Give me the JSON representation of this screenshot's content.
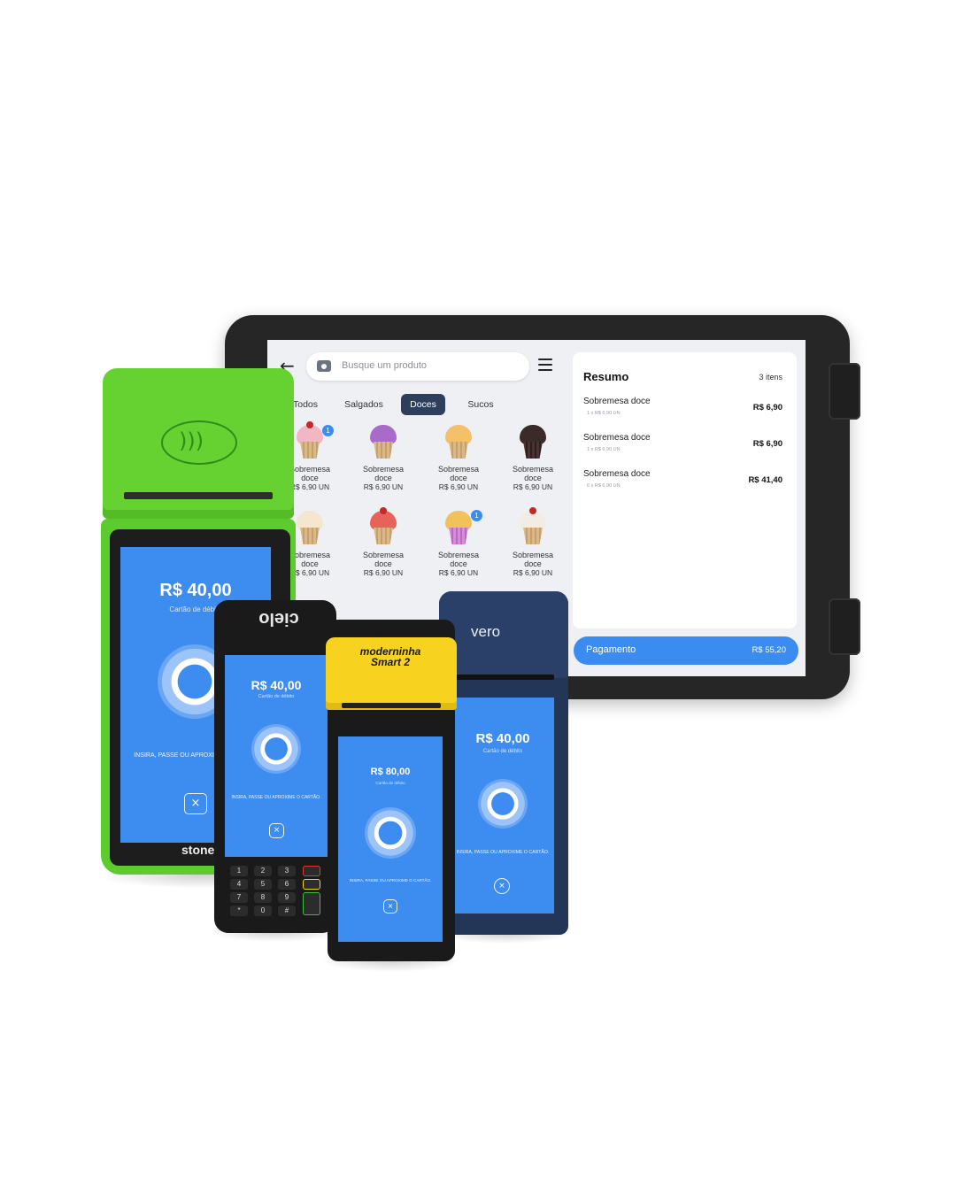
{
  "tablet_app": {
    "search": {
      "placeholder": "Busque um produto"
    },
    "tabs": [
      {
        "label": "Todos"
      },
      {
        "label": "Salgados"
      },
      {
        "label": "Doces",
        "active": true
      },
      {
        "label": "Sucos"
      }
    ],
    "products": [
      {
        "name_line1": "Sobremesa",
        "name_line2": "doce",
        "price": "R$ 6,90 UN",
        "badge": "1"
      },
      {
        "name_line1": "Sobremesa",
        "name_line2": "doce",
        "price": "R$ 6,90 UN"
      },
      {
        "name_line1": "Sobremesa",
        "name_line2": "doce",
        "price": "R$ 6,90 UN"
      },
      {
        "name_line1": "Sobremesa",
        "name_line2": "doce",
        "price": "R$ 6,90 UN"
      },
      {
        "name_line1": "Sobremesa",
        "name_line2": "doce",
        "price": "R$ 6,90 UN"
      },
      {
        "name_line1": "Sobremesa",
        "name_line2": "doce",
        "price": "R$ 6,90 UN"
      },
      {
        "name_line1": "Sobremesa",
        "name_line2": "doce",
        "price": "R$ 6,90 UN",
        "badge": "1"
      },
      {
        "name_line1": "Sobremesa",
        "name_line2": "doce",
        "price": "R$ 6,90 UN"
      }
    ],
    "summary": {
      "title": "Resumo",
      "count": "3 itens",
      "items": [
        {
          "name": "Sobremesa doce",
          "detail": "1 x R$ 6,90 UN",
          "price": "R$ 6,90"
        },
        {
          "name": "Sobremesa doce",
          "detail": "1 x R$ 6,90 UN",
          "price": "R$ 6,90"
        },
        {
          "name": "Sobremesa doce",
          "detail": "6 x R$ 6,90 UN",
          "price": "R$ 41,40"
        }
      ]
    },
    "payment": {
      "label": "Pagamento",
      "total": "R$ 55,20"
    }
  },
  "devices": {
    "stone": {
      "brand": "stone",
      "amount": "R$ 40,00",
      "method": "Cartão de débito",
      "instruction": "INSIRA, PASSE OU APROXIME O CARTÃO",
      "cancel": "×"
    },
    "cielo": {
      "brand": "cielo",
      "amount": "R$ 40,00",
      "method": "Cartão de débito",
      "instruction": "INSIRA, PASSE OU APROXIME O CARTÃO.",
      "cancel": "×",
      "keys": [
        "1",
        "2",
        "3",
        "4",
        "5",
        "6",
        "7",
        "8",
        "9",
        "*",
        "0",
        "#"
      ]
    },
    "moderninha": {
      "brand_line1": "moderninha",
      "brand_line2": "Smart 2",
      "amount": "R$ 80,00",
      "method": "Cartão de débito",
      "instruction": "INSIRA, PASSE OU APROXIME O CARTÃO.",
      "cancel": "×"
    },
    "vero": {
      "brand": "vero",
      "amount": "R$ 40,00",
      "method": "Cartão de débito",
      "instruction": "INSIRA, PASSE OU APROXIME O CARTÃO.",
      "cancel": "×"
    }
  },
  "colors": {
    "accent_blue": "#3d8cf0",
    "stone_green": "#66d232",
    "moderninha_yellow": "#f7d21e",
    "vero_navy": "#233657",
    "active_tab": "#2d3f5c"
  },
  "icons": {
    "back": "arrow-left-icon",
    "search": "camera-icon",
    "menu": "hamburger-menu-icon",
    "contactless": "contactless-icon",
    "cancel": "close-icon"
  }
}
